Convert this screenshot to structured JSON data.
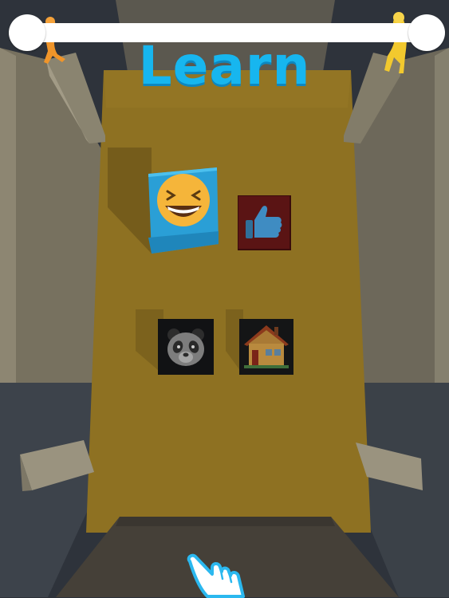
{
  "hud": {
    "title": "Learn"
  },
  "tiles": [
    {
      "icon": "laughing-face-icon",
      "state": "selected"
    },
    {
      "icon": "thumbs-up-icon",
      "state": "idle"
    },
    {
      "icon": "panda-icon",
      "state": "idle"
    },
    {
      "icon": "house-icon",
      "state": "idle"
    }
  ],
  "tutorial": {
    "icon": "pointing-hand-icon"
  },
  "colors": {
    "floor": "#8e7122",
    "accent": "#17b6ef",
    "selected_tile": "#29a6dc",
    "wall": "#6f6a5c",
    "background": "#2c3139"
  }
}
